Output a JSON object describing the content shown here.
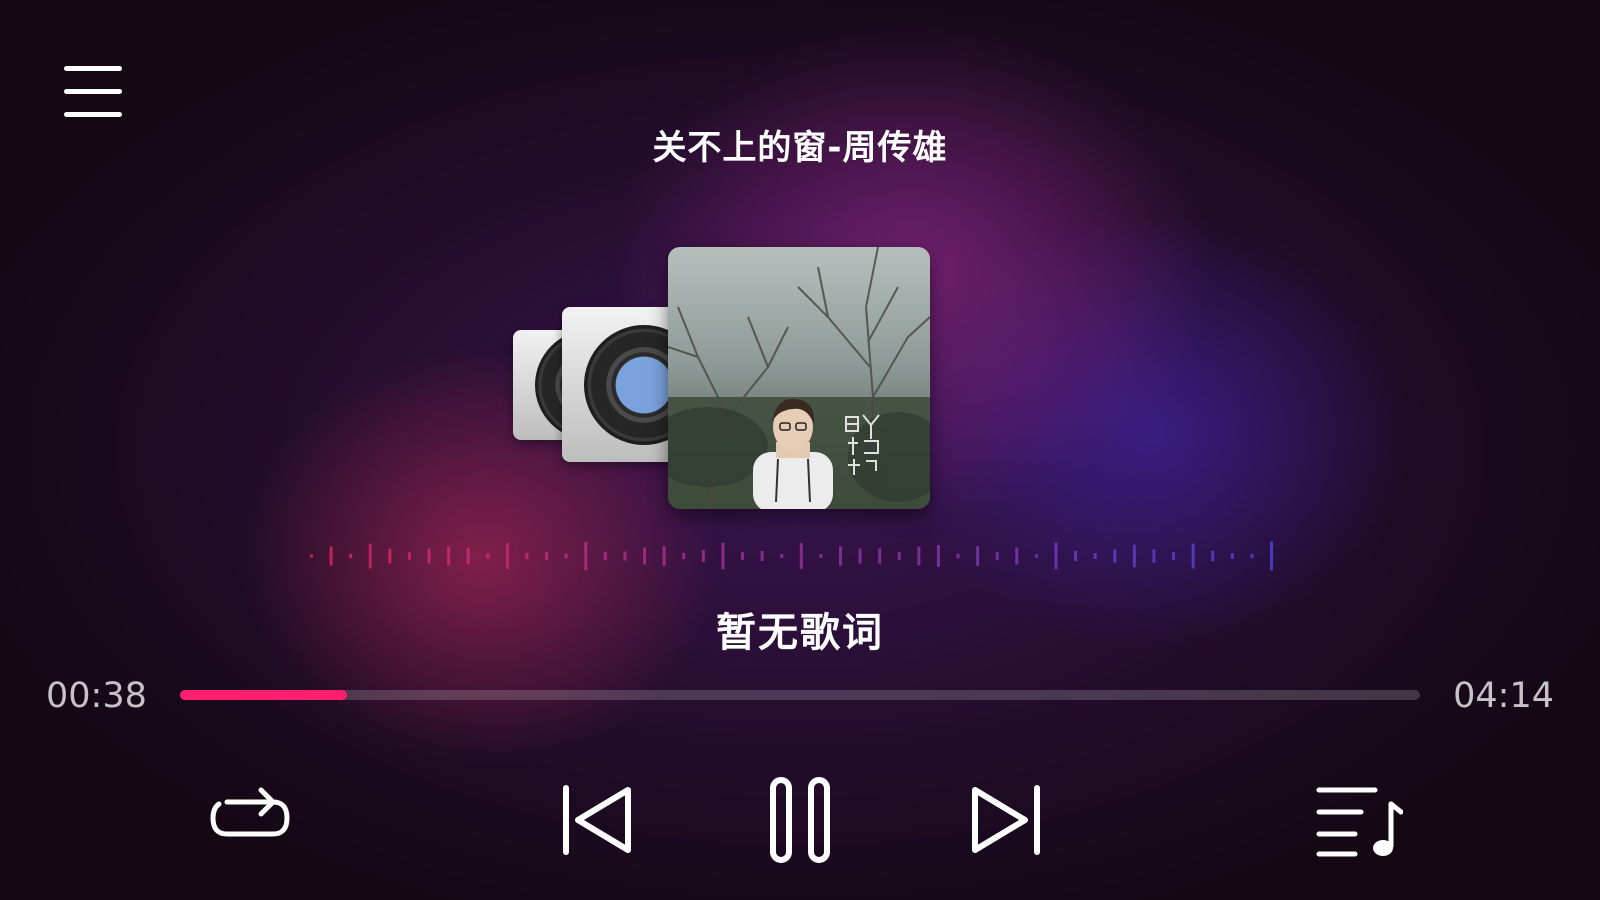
{
  "song": {
    "title": "关不上的窗-周传雄"
  },
  "lyrics": {
    "text": "暂无歌词"
  },
  "playback": {
    "current_time": "00:38",
    "total_time": "04:14",
    "progress_fraction": 0.135,
    "state": "playing"
  },
  "icons": {
    "menu": "hamburger-menu-icon",
    "repeat": "repeat-icon",
    "previous": "skip-previous-icon",
    "pause": "pause-icon",
    "next": "skip-next-icon",
    "playlist": "playlist-icon"
  },
  "colors": {
    "accent": "#ff1f6e",
    "text": "#ffffff",
    "time_text": "#c8c2c8"
  }
}
